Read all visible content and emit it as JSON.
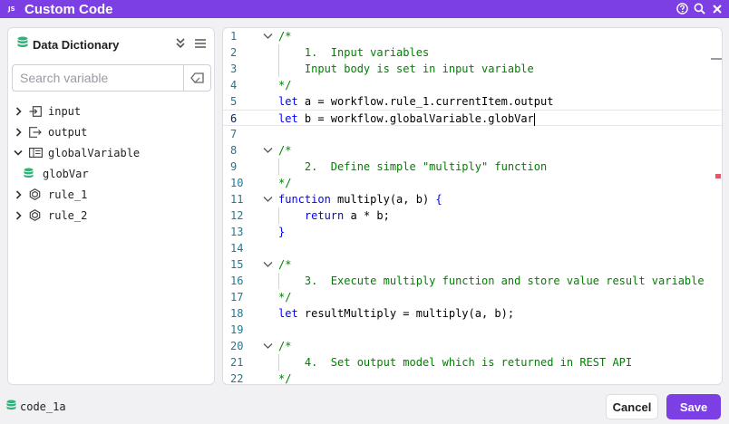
{
  "window": {
    "icon_text": "JS",
    "title": "Custom Code",
    "actions": [
      "help-icon",
      "search-icon",
      "close-icon"
    ]
  },
  "colors": {
    "accent": "#7b3fe4",
    "keyword": "#0000ff",
    "comment": "#008000",
    "line_number": "#237893",
    "db_icon": "#2fb37a"
  },
  "sidebar": {
    "title": "Data Dictionary",
    "search_placeholder": "Search variable",
    "tree": [
      {
        "label": "input",
        "icon": "input-icon",
        "expanded": false
      },
      {
        "label": "output",
        "icon": "output-icon",
        "expanded": false
      },
      {
        "label": "globalVariable",
        "icon": "global-variable-icon",
        "expanded": true
      },
      {
        "label": "globVar",
        "icon": "database-icon",
        "child": true
      },
      {
        "label": "rule_1",
        "icon": "hexagon-icon",
        "expanded": false
      },
      {
        "label": "rule_2",
        "icon": "hexagon-icon",
        "expanded": false
      }
    ]
  },
  "editor": {
    "active_line": 6,
    "lines": [
      {
        "n": "1",
        "fold": true,
        "segs": [
          {
            "c": "cm",
            "t": "/*"
          }
        ]
      },
      {
        "n": "2",
        "segs": [
          {
            "c": "cm",
            "t": "    1.  Input variables"
          }
        ]
      },
      {
        "n": "3",
        "segs": [
          {
            "c": "cm",
            "t": "    Input body is set in input variable"
          }
        ]
      },
      {
        "n": "4",
        "segs": [
          {
            "c": "cm",
            "t": "*/"
          }
        ]
      },
      {
        "n": "5",
        "segs": [
          {
            "c": "kw",
            "t": "let"
          },
          {
            "c": "",
            "t": " a = workflow.rule_1.currentItem.output"
          }
        ]
      },
      {
        "n": "6",
        "segs": [
          {
            "c": "kw",
            "t": "let"
          },
          {
            "c": "",
            "t": " b = workflow.globalVariable.globVar"
          }
        ],
        "cursor": true
      },
      {
        "n": "7",
        "segs": []
      },
      {
        "n": "8",
        "fold": true,
        "segs": [
          {
            "c": "cm",
            "t": "/*"
          }
        ]
      },
      {
        "n": "9",
        "segs": [
          {
            "c": "cm",
            "t": "    2.  Define simple \"multiply\" function"
          }
        ]
      },
      {
        "n": "10",
        "segs": [
          {
            "c": "cm",
            "t": "*/"
          }
        ]
      },
      {
        "n": "11",
        "fold": true,
        "segs": [
          {
            "c": "kw",
            "t": "function"
          },
          {
            "c": "",
            "t": " multiply(a, b) "
          },
          {
            "c": "kw",
            "t": "{"
          }
        ]
      },
      {
        "n": "12",
        "segs": [
          {
            "c": "",
            "t": "    "
          },
          {
            "c": "kw",
            "t": "return"
          },
          {
            "c": "",
            "t": " a * b;"
          }
        ]
      },
      {
        "n": "13",
        "segs": [
          {
            "c": "kw",
            "t": "}"
          }
        ]
      },
      {
        "n": "14",
        "segs": []
      },
      {
        "n": "15",
        "fold": true,
        "segs": [
          {
            "c": "cm",
            "t": "/*"
          }
        ]
      },
      {
        "n": "16",
        "segs": [
          {
            "c": "cm",
            "t": "    3.  Execute multiply function and store value result variable"
          }
        ]
      },
      {
        "n": "17",
        "segs": [
          {
            "c": "cm",
            "t": "*/"
          }
        ]
      },
      {
        "n": "18",
        "segs": [
          {
            "c": "kw",
            "t": "let"
          },
          {
            "c": "",
            "t": " resultMultiply = multiply(a, b);"
          }
        ]
      },
      {
        "n": "19",
        "segs": []
      },
      {
        "n": "20",
        "fold": true,
        "segs": [
          {
            "c": "cm",
            "t": "/*"
          }
        ]
      },
      {
        "n": "21",
        "segs": [
          {
            "c": "cm",
            "t": "    4.  Set output model which is returned in REST API"
          }
        ]
      },
      {
        "n": "22",
        "segs": [
          {
            "c": "cm",
            "t": "*/"
          }
        ]
      }
    ]
  },
  "footer": {
    "code_name": "code_1a",
    "cancel_label": "Cancel",
    "save_label": "Save"
  }
}
